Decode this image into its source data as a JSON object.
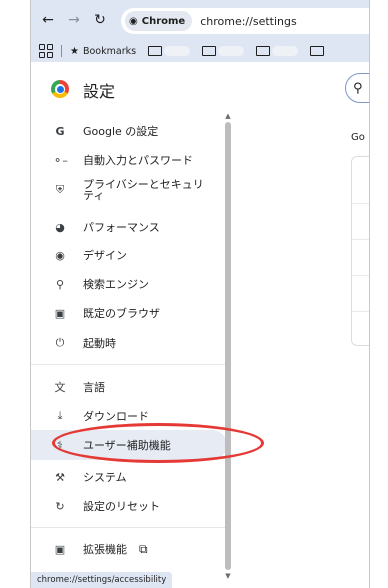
{
  "browser": {
    "chip_label": "Chrome",
    "url": "chrome://settings",
    "bookmarks_label": "Bookmarks"
  },
  "header": {
    "title": "設定"
  },
  "sidebar": {
    "items": [
      {
        "label": "Google の設定",
        "icon": "google-icon"
      },
      {
        "label": "自動入力とパスワード",
        "icon": "key-icon"
      },
      {
        "label": "プライバシーとセキュリティ",
        "icon": "shield-icon"
      },
      {
        "label": "パフォーマンス",
        "icon": "speedometer-icon"
      },
      {
        "label": "デザイン",
        "icon": "palette-icon"
      },
      {
        "label": "検索エンジン",
        "icon": "search-icon"
      },
      {
        "label": "既定のブラウザ",
        "icon": "browser-window-icon"
      },
      {
        "label": "起動時",
        "icon": "power-icon"
      },
      {
        "label": "言語",
        "icon": "translate-icon"
      },
      {
        "label": "ダウンロード",
        "icon": "download-icon"
      },
      {
        "label": "ユーザー補助機能",
        "icon": "accessibility-icon"
      },
      {
        "label": "システム",
        "icon": "wrench-icon"
      },
      {
        "label": "設定のリセット",
        "icon": "reset-icon"
      },
      {
        "label": "拡張機能",
        "icon": "extension-icon"
      }
    ]
  },
  "content": {
    "section_label": "Go"
  },
  "status_bar": {
    "text": "chrome://settings/accessibility"
  },
  "colors": {
    "toolbar": "#dfe6f3",
    "active_item": "#e6ebf4",
    "highlight": "#e53935"
  }
}
